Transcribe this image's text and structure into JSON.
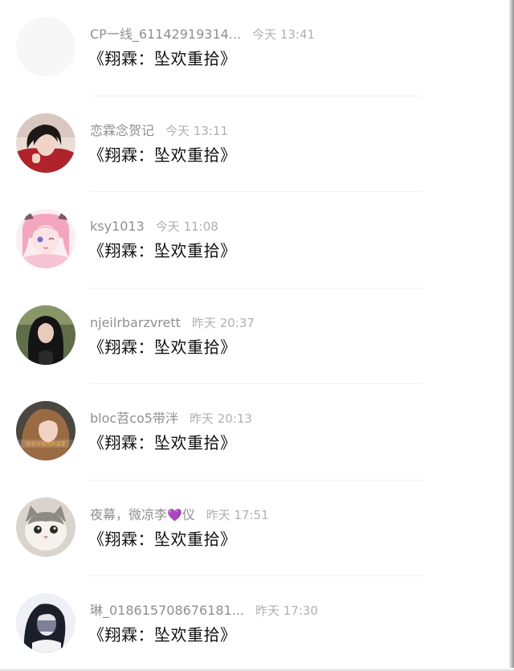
{
  "comments": [
    {
      "username": "CP一线_61142919314...",
      "time": "今天 13:41",
      "message": "《翔霖：坠欢重拾》",
      "avatar": "blank-avatar-icon"
    },
    {
      "username": "恋霖念贺记",
      "time": "今天 13:11",
      "message": "《翔霖：坠欢重拾》",
      "avatar": "girl-in-red-avatar"
    },
    {
      "username": "ksy1013",
      "time": "今天 11:08",
      "message": "《翔霖：坠欢重拾》",
      "avatar": "pink-anime-girl-avatar"
    },
    {
      "username": "njeilrbarzvrett",
      "time": "昨天 20:37",
      "message": "《翔霖：坠欢重拾》",
      "avatar": "dark-hair-girl-avatar"
    },
    {
      "username": "bloc苕co5带泮",
      "time": "昨天 20:13",
      "message": "《翔霖：坠欢重拾》",
      "avatar": "brown-hair-girl-avatar",
      "avatar_caption": "你若对城市的温柔"
    },
    {
      "username_prefix": "夜幕，微凉李",
      "username_emoji": "💜",
      "username_suffix": "仪",
      "time": "昨天 17:51",
      "message": "《翔霖：坠欢重拾》",
      "avatar": "cat-avatar"
    },
    {
      "username": "琳_018615708676181...",
      "time": "昨天 17:30",
      "message": "《翔霖：坠欢重拾》",
      "avatar": "masked-girl-avatar"
    }
  ],
  "colors": {
    "username": "#8f8f8f",
    "time": "#b0b0b0",
    "message": "#111111",
    "divider": "#f0f0f0",
    "heart": "#a64de0"
  }
}
